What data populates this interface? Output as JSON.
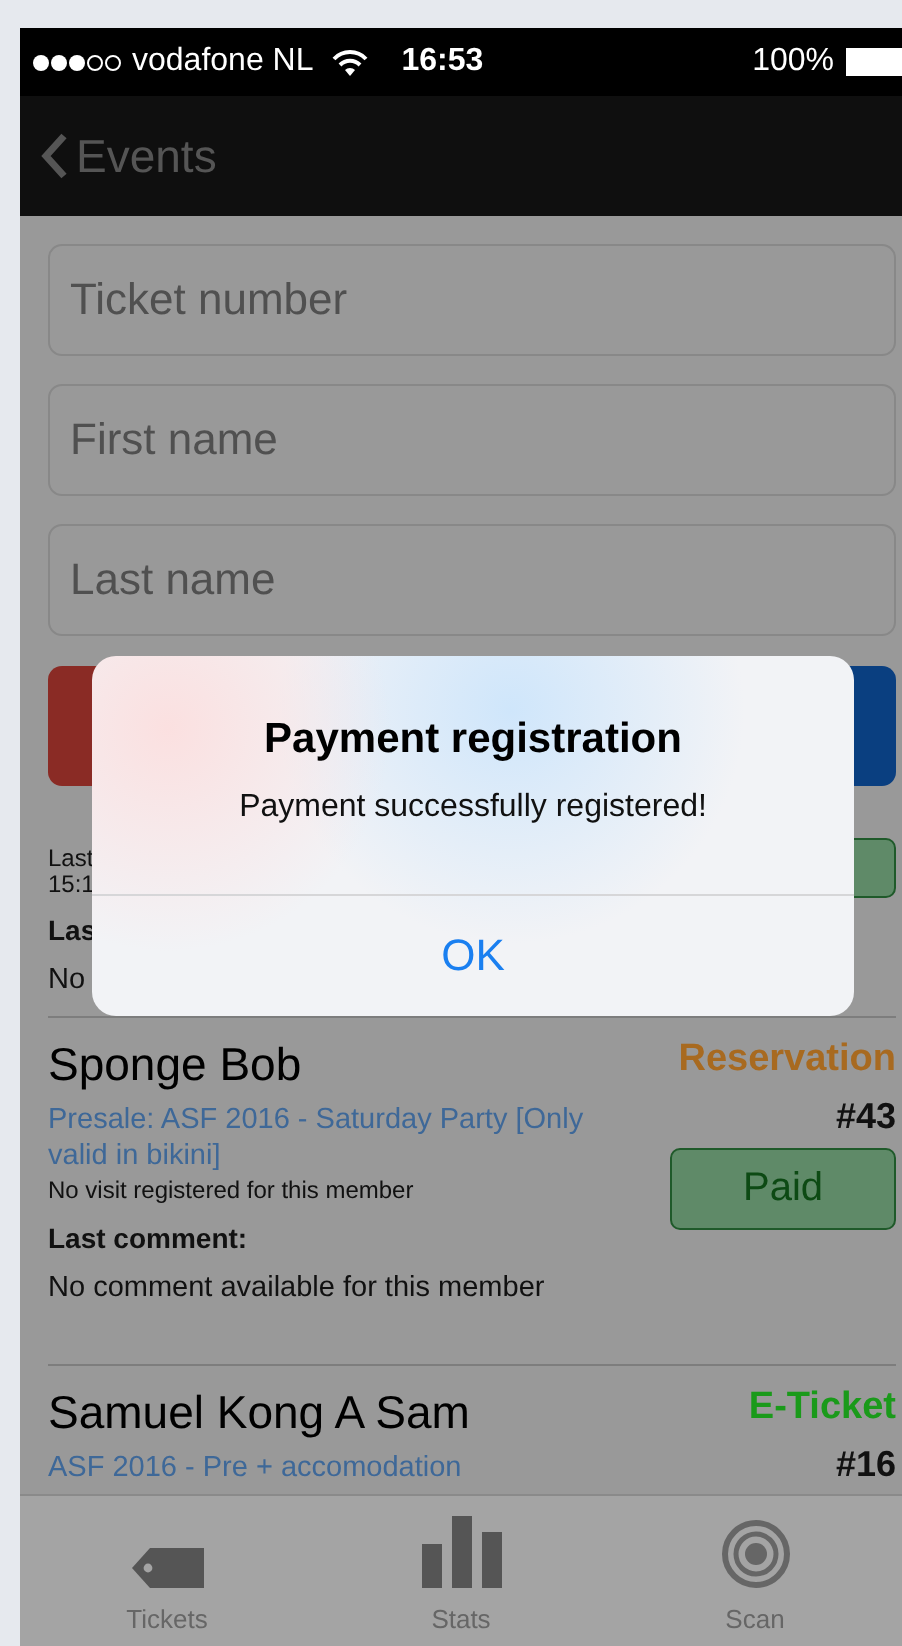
{
  "status_bar": {
    "carrier": "vodafone NL",
    "time": "16:53",
    "battery": "100%"
  },
  "nav": {
    "back_label": "Events"
  },
  "search_fields": [
    {
      "placeholder": "Ticket number"
    },
    {
      "placeholder": "First name"
    },
    {
      "placeholder": "Last name"
    }
  ],
  "action_buttons": [
    {
      "color": "#8a2b25"
    },
    {
      "color": "#0a3f80"
    }
  ],
  "partial_member": {
    "visit_lines": [
      "Last",
      "15:1"
    ],
    "comment_label": "Las",
    "comment": "No"
  },
  "members": [
    {
      "name": "Sponge Bob",
      "ticket_type": "Reservation",
      "color": "#a86a20",
      "number": "#43",
      "event": "Presale: ASF 2016 - Saturday Party [Only valid in bikini]",
      "visit": "No visit registered for this member",
      "comment_label": "Last comment:",
      "comment": "No comment available for this member",
      "payment": "Paid"
    },
    {
      "name": "Samuel Kong A Sam",
      "ticket_type": "E-Ticket",
      "color": "#1a9a1a",
      "number": "#16",
      "event": "ASF 2016 - Pre + accomodation"
    }
  ],
  "tab_bar": [
    {
      "label": "Tickets",
      "kind": "tag"
    },
    {
      "label": "Stats",
      "kind": "chart"
    },
    {
      "label": "Scan",
      "kind": "target"
    }
  ],
  "alert": {
    "title": "Payment registration",
    "message": "Payment successfully registered!",
    "button": "OK"
  }
}
